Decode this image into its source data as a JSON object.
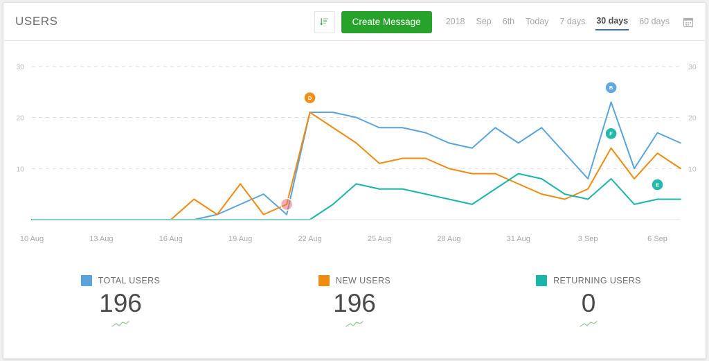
{
  "header": {
    "title": "USERS",
    "sort_icon": "sort-amount-icon",
    "create_button_label": "Create Message",
    "calendar_icon": "calendar-icon",
    "ranges": [
      {
        "label": "2018",
        "active": false
      },
      {
        "label": "Sep",
        "active": false
      },
      {
        "label": "6th",
        "active": false
      },
      {
        "label": "Today",
        "active": false
      },
      {
        "label": "7 days",
        "active": false
      },
      {
        "label": "30 days",
        "active": true
      },
      {
        "label": "60 days",
        "active": false
      }
    ]
  },
  "colors": {
    "total_users": "#5ba3dc",
    "new_users": "#ef8b10",
    "returning_users": "#19b5a8",
    "accent_green": "#27a22b",
    "active_underline": "#3d6f9c",
    "grid": "#dddddd",
    "badge_red": "#e8736d"
  },
  "legend": [
    {
      "label": "TOTAL USERS",
      "value": "196",
      "color": "#5ba3dc",
      "trend_icon": "trend-up-icon"
    },
    {
      "label": "NEW USERS",
      "value": "196",
      "color": "#ef8b10",
      "trend_icon": "trend-up-icon"
    },
    {
      "label": "RETURNING USERS",
      "value": "0",
      "color": "#19b5a8",
      "trend_icon": "trend-up-icon"
    }
  ],
  "chart_data": {
    "type": "line",
    "title": "USERS",
    "xlabel": "",
    "ylabel": "",
    "ylim": [
      0,
      32
    ],
    "yticks": [
      10,
      20,
      30
    ],
    "ytick_labels_left": [
      "10",
      "20",
      "30"
    ],
    "ytick_labels_right": [
      "10",
      "20",
      "30"
    ],
    "grid": true,
    "legend_position": "bottom",
    "x": [
      "10 Aug",
      "11 Aug",
      "12 Aug",
      "13 Aug",
      "14 Aug",
      "15 Aug",
      "16 Aug",
      "17 Aug",
      "18 Aug",
      "19 Aug",
      "20 Aug",
      "21 Aug",
      "22 Aug",
      "23 Aug",
      "24 Aug",
      "25 Aug",
      "26 Aug",
      "27 Aug",
      "28 Aug",
      "29 Aug",
      "30 Aug",
      "31 Aug",
      "1 Sep",
      "2 Sep",
      "3 Sep",
      "4 Sep",
      "5 Sep",
      "6 Sep",
      "7 Sep"
    ],
    "xticks": [
      "10 Aug",
      "13 Aug",
      "16 Aug",
      "19 Aug",
      "22 Aug",
      "25 Aug",
      "28 Aug",
      "31 Aug",
      "3 Sep",
      "6 Sep"
    ],
    "series": [
      {
        "name": "TOTAL USERS",
        "color": "#5ba3dc",
        "values": [
          0,
          0,
          0,
          0,
          0,
          0,
          0,
          0,
          1,
          3,
          5,
          1,
          21,
          21,
          20,
          18,
          18,
          17,
          15,
          14,
          18,
          15,
          18,
          13,
          8,
          23,
          10,
          17,
          15,
          0
        ]
      },
      {
        "name": "NEW USERS",
        "color": "#ef8b10",
        "values": [
          0,
          0,
          0,
          0,
          0,
          0,
          0,
          4,
          1,
          7,
          1,
          3,
          21,
          18,
          15,
          11,
          12,
          12,
          10,
          9,
          9,
          7,
          5,
          4,
          6,
          14,
          8,
          13,
          10,
          0
        ]
      },
      {
        "name": "RETURNING USERS",
        "color": "#19b5a8",
        "values": [
          0,
          0,
          0,
          0,
          0,
          0,
          0,
          0,
          0,
          0,
          0,
          0,
          0,
          3,
          7,
          6,
          6,
          5,
          4,
          3,
          6,
          9,
          8,
          5,
          4,
          8,
          3,
          4,
          4,
          0
        ]
      }
    ],
    "annotations": [
      {
        "label": "D",
        "series": "NEW USERS",
        "x": "22 Aug",
        "value": 21,
        "color": "#ef8b10"
      },
      {
        "label": "",
        "series": "NEW USERS",
        "x": "21 Aug",
        "value": 3,
        "color": "#e8736d"
      },
      {
        "label": "B",
        "series": "TOTAL USERS",
        "x": "4 Sep",
        "value": 23,
        "color": "#5ba3dc"
      },
      {
        "label": "F",
        "series": "NEW USERS",
        "x": "4 Sep",
        "value": 14,
        "color": "#19b5a8"
      },
      {
        "label": "E",
        "series": "RETURNING USERS",
        "x": "6 Sep",
        "value": 4,
        "color": "#19b5a8"
      }
    ]
  }
}
